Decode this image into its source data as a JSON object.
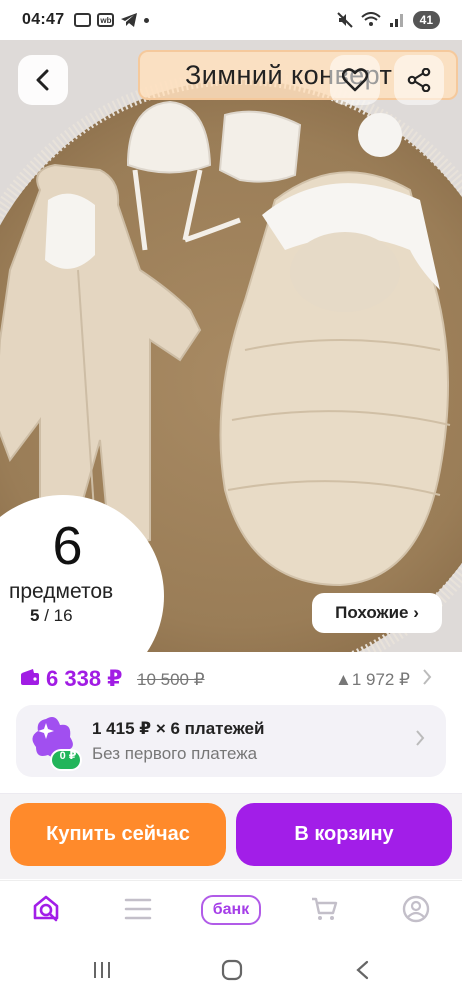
{
  "status_bar": {
    "time": "04:47",
    "wb_label": "wb",
    "battery": "41"
  },
  "header": {
    "title": "Зимний конверт"
  },
  "gallery": {
    "items_count": "6",
    "items_label": "предметов",
    "current_page": "5",
    "page_separator": " / ",
    "total_pages": "16",
    "similar_label": "Похожие ›"
  },
  "price": {
    "current": "6 338 ₽",
    "old": "10 500 ₽",
    "change": "▲1 972 ₽"
  },
  "installment": {
    "badge": "0 ₽",
    "title": "1 415 ₽ × 6 платежей",
    "subtitle": "Без первого платежа"
  },
  "actions": {
    "buy_now": "Купить сейчас",
    "add_to_cart": "В корзину"
  },
  "tabbar": {
    "bank_label": "банк"
  },
  "colors": {
    "accent": "#a21ee8",
    "buy": "#ff8a2b",
    "price": "#a11ce4"
  }
}
